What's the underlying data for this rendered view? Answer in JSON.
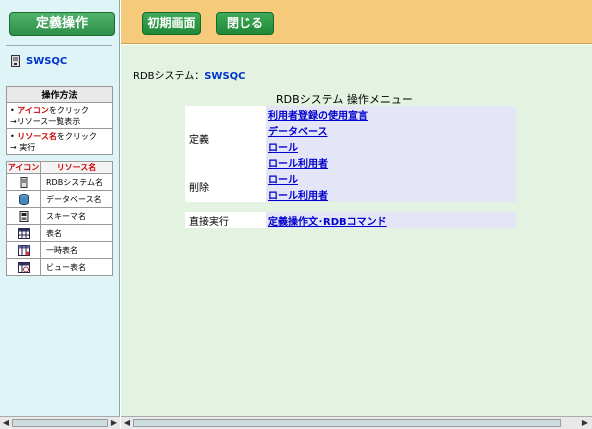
{
  "left": {
    "title_button": "定義操作",
    "system_link": "SWSQC",
    "howto": {
      "heading": "操作方法",
      "items": [
        {
          "bullet": "•",
          "red": "アイコン",
          "rest": "をクリック",
          "line2": "→リソース一覧表示"
        },
        {
          "bullet": "•",
          "red": "リソース名",
          "rest": "をクリック",
          "line2": "→ 実行"
        }
      ]
    },
    "legend": {
      "col_icon": "アイコン",
      "col_name": "リソース名",
      "rows": [
        {
          "icon": "server-icon",
          "name": "RDBシステム名"
        },
        {
          "icon": "database-icon",
          "name": "データベース名"
        },
        {
          "icon": "schema-icon",
          "name": "スキーマ名"
        },
        {
          "icon": "table-icon",
          "name": "表名"
        },
        {
          "icon": "temp-table-icon",
          "name": "一時表名"
        },
        {
          "icon": "view-icon",
          "name": "ビュー表名"
        }
      ]
    }
  },
  "toolbar": {
    "init_label": "初期画面",
    "close_label": "閉じる"
  },
  "main": {
    "rdb_label": "RDBシステム：",
    "rdb_name": "SWSQC",
    "menu_title": "RDBシステム 操作メニュー",
    "define": {
      "category": "定義",
      "links": [
        "利用者登録の使用宣言",
        "データベース",
        "ロール",
        "ロール利用者"
      ]
    },
    "delete": {
      "category": "削除",
      "links": [
        "ロール",
        "ロール利用者"
      ]
    },
    "direct": {
      "category": "直接実行",
      "link": "定義操作文･RDBコマンド"
    }
  },
  "colors": {
    "accent_green": "#2f8f48",
    "top_bar": "#f5ca7a",
    "main_bg": "#e4f2e2",
    "left_bg": "#dff4f7",
    "link": "#0000cc"
  }
}
